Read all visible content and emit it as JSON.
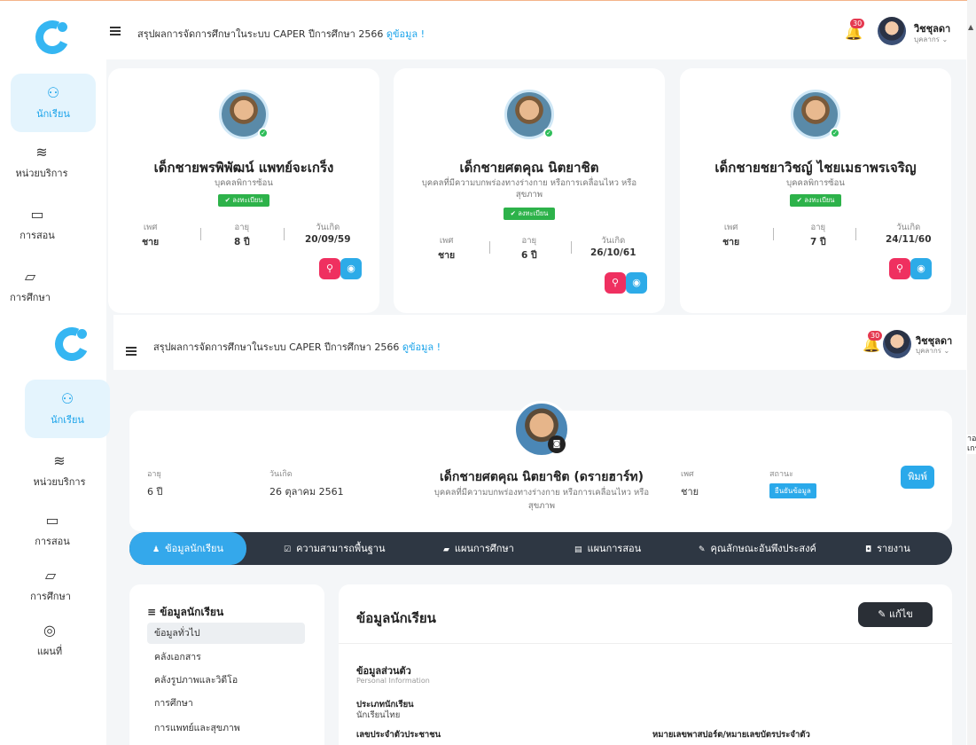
{
  "topbar": {
    "summary_text": "สรุปผลการจัดการศึกษาในระบบ CAPER ปีการศึกษา 2566",
    "summary_link": "ดูข้อมูล !",
    "notification_count": "30",
    "user_name": "วิชชุลดา",
    "user_role": "บุคลากร"
  },
  "sidebar": {
    "items": [
      {
        "label": "นักเรียน"
      },
      {
        "label": "หน่วยบริการ"
      },
      {
        "label": "การสอน"
      },
      {
        "label": "การศึกษา"
      },
      {
        "label": "แผนที่"
      }
    ]
  },
  "cards": [
    {
      "name": "เด็กชายพรพิพัฒน์ แพทย์จะเกร็ง",
      "type": "บุคคลพิการซ้อน",
      "badge": "✔ ลงทะเบียน",
      "sex_label": "เพศ",
      "sex": "ชาย",
      "age_label": "อายุ",
      "age": "8 ปี",
      "dob_label": "วันเกิด",
      "dob": "20/09/59"
    },
    {
      "name": "เด็กชายศตคุณ นิตยาชิต",
      "type": "บุคคลที่มีความบกพร่องทางร่างกาย หรือการเคลื่อนไหว หรือสุขภาพ",
      "badge": "✔ ลงทะเบียน",
      "sex_label": "เพศ",
      "sex": "ชาย",
      "age_label": "อายุ",
      "age": "6 ปี",
      "dob_label": "วันเกิด",
      "dob": "26/10/61"
    },
    {
      "name": "เด็กชายชยาวิชญ์ ไชยเมธาพรเจริญ",
      "type": "บุคคลพิการซ้อน",
      "badge": "✔ ลงทะเบียน",
      "sex_label": "เพศ",
      "sex": "ชาย",
      "age_label": "อายุ",
      "age": "7 ปี",
      "dob_label": "วันเกิด",
      "dob": "24/11/60"
    }
  ],
  "profile": {
    "age_label": "อายุ",
    "age": "6 ปี",
    "dob_label": "วันเกิด",
    "dob": "26 ตุลาคม 2561",
    "name": "เด็กชายศตคุณ นิตยาชิต (ดรายฮาร์ท)",
    "type": "บุคคลที่มีความบกพร่องทางร่างกาย หรือการเคลื่อนไหว หรือสุขภาพ",
    "sex_label": "เพศ",
    "sex": "ชาย",
    "status_label": "สถานะ",
    "status": "ยืนยันข้อมูล",
    "print_label": "พิมพ์"
  },
  "tabs": [
    {
      "label": "ข้อมูลนักเรียน"
    },
    {
      "label": "ความสามารถพื้นฐาน"
    },
    {
      "label": "แผนการศึกษา"
    },
    {
      "label": "แผนการสอน"
    },
    {
      "label": "คุณลักษณะอันพึงประสงค์"
    },
    {
      "label": "รายงาน"
    }
  ],
  "left_panel": {
    "title": "ข้อมูลนักเรียน",
    "items": [
      {
        "label": "ข้อมูลทั่วไป"
      },
      {
        "label": "คลังเอกสาร"
      },
      {
        "label": "คลังรูปภาพและวิดีโอ"
      },
      {
        "label": "การศึกษา"
      },
      {
        "label": "การแพทย์และสุขภาพ"
      }
    ]
  },
  "right_panel": {
    "title": "ข้อมูลนักเรียน",
    "edit_label": "แก้ไข",
    "section_title": "ข้อมูลส่วนตัว",
    "section_sub": "Personal Information",
    "student_type_label": "ประเภทนักเรียน",
    "student_type": "นักเรียนไทย",
    "id_label": "เลขประจำตัวประชาชน",
    "passport_label": "หมายเลขพาสปอร์ต/หมายเลขบัตรประจำตัว"
  },
  "edge_text": "าอ\nเกร"
}
